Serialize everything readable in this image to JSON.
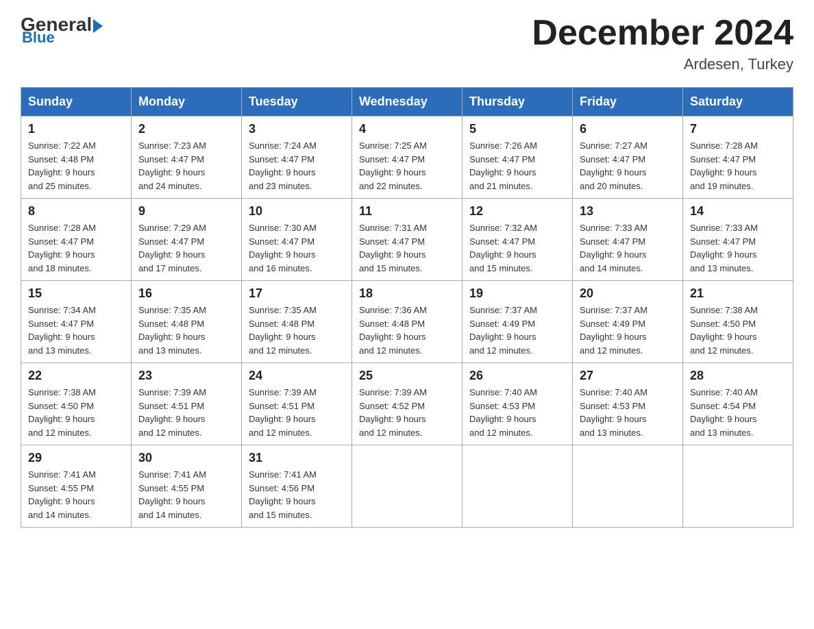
{
  "logo": {
    "general": "General",
    "blue": "Blue"
  },
  "header": {
    "month_year": "December 2024",
    "location": "Ardesen, Turkey"
  },
  "weekdays": [
    "Sunday",
    "Monday",
    "Tuesday",
    "Wednesday",
    "Thursday",
    "Friday",
    "Saturday"
  ],
  "weeks": [
    [
      {
        "day": "1",
        "sunrise": "7:22 AM",
        "sunset": "4:48 PM",
        "daylight": "9 hours and 25 minutes."
      },
      {
        "day": "2",
        "sunrise": "7:23 AM",
        "sunset": "4:47 PM",
        "daylight": "9 hours and 24 minutes."
      },
      {
        "day": "3",
        "sunrise": "7:24 AM",
        "sunset": "4:47 PM",
        "daylight": "9 hours and 23 minutes."
      },
      {
        "day": "4",
        "sunrise": "7:25 AM",
        "sunset": "4:47 PM",
        "daylight": "9 hours and 22 minutes."
      },
      {
        "day": "5",
        "sunrise": "7:26 AM",
        "sunset": "4:47 PM",
        "daylight": "9 hours and 21 minutes."
      },
      {
        "day": "6",
        "sunrise": "7:27 AM",
        "sunset": "4:47 PM",
        "daylight": "9 hours and 20 minutes."
      },
      {
        "day": "7",
        "sunrise": "7:28 AM",
        "sunset": "4:47 PM",
        "daylight": "9 hours and 19 minutes."
      }
    ],
    [
      {
        "day": "8",
        "sunrise": "7:28 AM",
        "sunset": "4:47 PM",
        "daylight": "9 hours and 18 minutes."
      },
      {
        "day": "9",
        "sunrise": "7:29 AM",
        "sunset": "4:47 PM",
        "daylight": "9 hours and 17 minutes."
      },
      {
        "day": "10",
        "sunrise": "7:30 AM",
        "sunset": "4:47 PM",
        "daylight": "9 hours and 16 minutes."
      },
      {
        "day": "11",
        "sunrise": "7:31 AM",
        "sunset": "4:47 PM",
        "daylight": "9 hours and 15 minutes."
      },
      {
        "day": "12",
        "sunrise": "7:32 AM",
        "sunset": "4:47 PM",
        "daylight": "9 hours and 15 minutes."
      },
      {
        "day": "13",
        "sunrise": "7:33 AM",
        "sunset": "4:47 PM",
        "daylight": "9 hours and 14 minutes."
      },
      {
        "day": "14",
        "sunrise": "7:33 AM",
        "sunset": "4:47 PM",
        "daylight": "9 hours and 13 minutes."
      }
    ],
    [
      {
        "day": "15",
        "sunrise": "7:34 AM",
        "sunset": "4:47 PM",
        "daylight": "9 hours and 13 minutes."
      },
      {
        "day": "16",
        "sunrise": "7:35 AM",
        "sunset": "4:48 PM",
        "daylight": "9 hours and 13 minutes."
      },
      {
        "day": "17",
        "sunrise": "7:35 AM",
        "sunset": "4:48 PM",
        "daylight": "9 hours and 12 minutes."
      },
      {
        "day": "18",
        "sunrise": "7:36 AM",
        "sunset": "4:48 PM",
        "daylight": "9 hours and 12 minutes."
      },
      {
        "day": "19",
        "sunrise": "7:37 AM",
        "sunset": "4:49 PM",
        "daylight": "9 hours and 12 minutes."
      },
      {
        "day": "20",
        "sunrise": "7:37 AM",
        "sunset": "4:49 PM",
        "daylight": "9 hours and 12 minutes."
      },
      {
        "day": "21",
        "sunrise": "7:38 AM",
        "sunset": "4:50 PM",
        "daylight": "9 hours and 12 minutes."
      }
    ],
    [
      {
        "day": "22",
        "sunrise": "7:38 AM",
        "sunset": "4:50 PM",
        "daylight": "9 hours and 12 minutes."
      },
      {
        "day": "23",
        "sunrise": "7:39 AM",
        "sunset": "4:51 PM",
        "daylight": "9 hours and 12 minutes."
      },
      {
        "day": "24",
        "sunrise": "7:39 AM",
        "sunset": "4:51 PM",
        "daylight": "9 hours and 12 minutes."
      },
      {
        "day": "25",
        "sunrise": "7:39 AM",
        "sunset": "4:52 PM",
        "daylight": "9 hours and 12 minutes."
      },
      {
        "day": "26",
        "sunrise": "7:40 AM",
        "sunset": "4:53 PM",
        "daylight": "9 hours and 12 minutes."
      },
      {
        "day": "27",
        "sunrise": "7:40 AM",
        "sunset": "4:53 PM",
        "daylight": "9 hours and 13 minutes."
      },
      {
        "day": "28",
        "sunrise": "7:40 AM",
        "sunset": "4:54 PM",
        "daylight": "9 hours and 13 minutes."
      }
    ],
    [
      {
        "day": "29",
        "sunrise": "7:41 AM",
        "sunset": "4:55 PM",
        "daylight": "9 hours and 14 minutes."
      },
      {
        "day": "30",
        "sunrise": "7:41 AM",
        "sunset": "4:55 PM",
        "daylight": "9 hours and 14 minutes."
      },
      {
        "day": "31",
        "sunrise": "7:41 AM",
        "sunset": "4:56 PM",
        "daylight": "9 hours and 15 minutes."
      },
      null,
      null,
      null,
      null
    ]
  ],
  "labels": {
    "sunrise": "Sunrise:",
    "sunset": "Sunset:",
    "daylight": "Daylight:"
  }
}
